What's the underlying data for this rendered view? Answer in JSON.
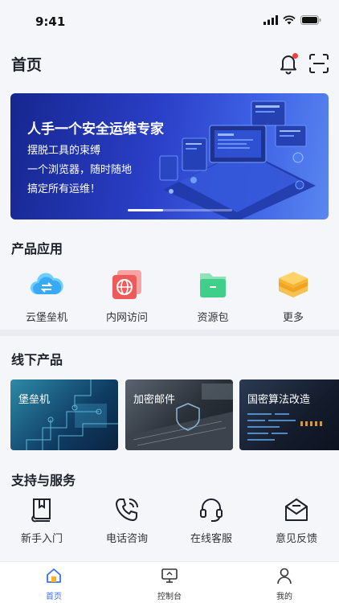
{
  "status_bar": {
    "time": "9:41"
  },
  "header": {
    "title": "首页"
  },
  "banner": {
    "title": "人手一个安全运维专家",
    "lines": [
      "摆脱工具的束缚",
      "一个浏览器，随时随地",
      "搞定所有运维！"
    ]
  },
  "products": {
    "title": "产品应用",
    "items": [
      {
        "label": "云堡垒机",
        "icon": "cloud-swap-icon"
      },
      {
        "label": "内网访问",
        "icon": "globe-icon"
      },
      {
        "label": "资源包",
        "icon": "folder-icon"
      },
      {
        "label": "更多",
        "icon": "layers-icon"
      }
    ]
  },
  "offline": {
    "title": "线下产品",
    "cards": [
      {
        "label": "堡垒机"
      },
      {
        "label": "加密邮件"
      },
      {
        "label": "国密算法改造"
      }
    ]
  },
  "support": {
    "title": "支持与服务",
    "items": [
      {
        "label": "新手入门",
        "icon": "book-icon"
      },
      {
        "label": "电话咨询",
        "icon": "phone-icon"
      },
      {
        "label": "在线客服",
        "icon": "headset-icon"
      },
      {
        "label": "意见反馈",
        "icon": "mail-icon"
      }
    ]
  },
  "tabbar": {
    "tabs": [
      {
        "label": "首页",
        "active": true
      },
      {
        "label": "控制台",
        "active": false
      },
      {
        "label": "我的",
        "active": false
      }
    ]
  },
  "colors": {
    "accent": "#3a6ff0",
    "notification": "#f53f3f"
  }
}
